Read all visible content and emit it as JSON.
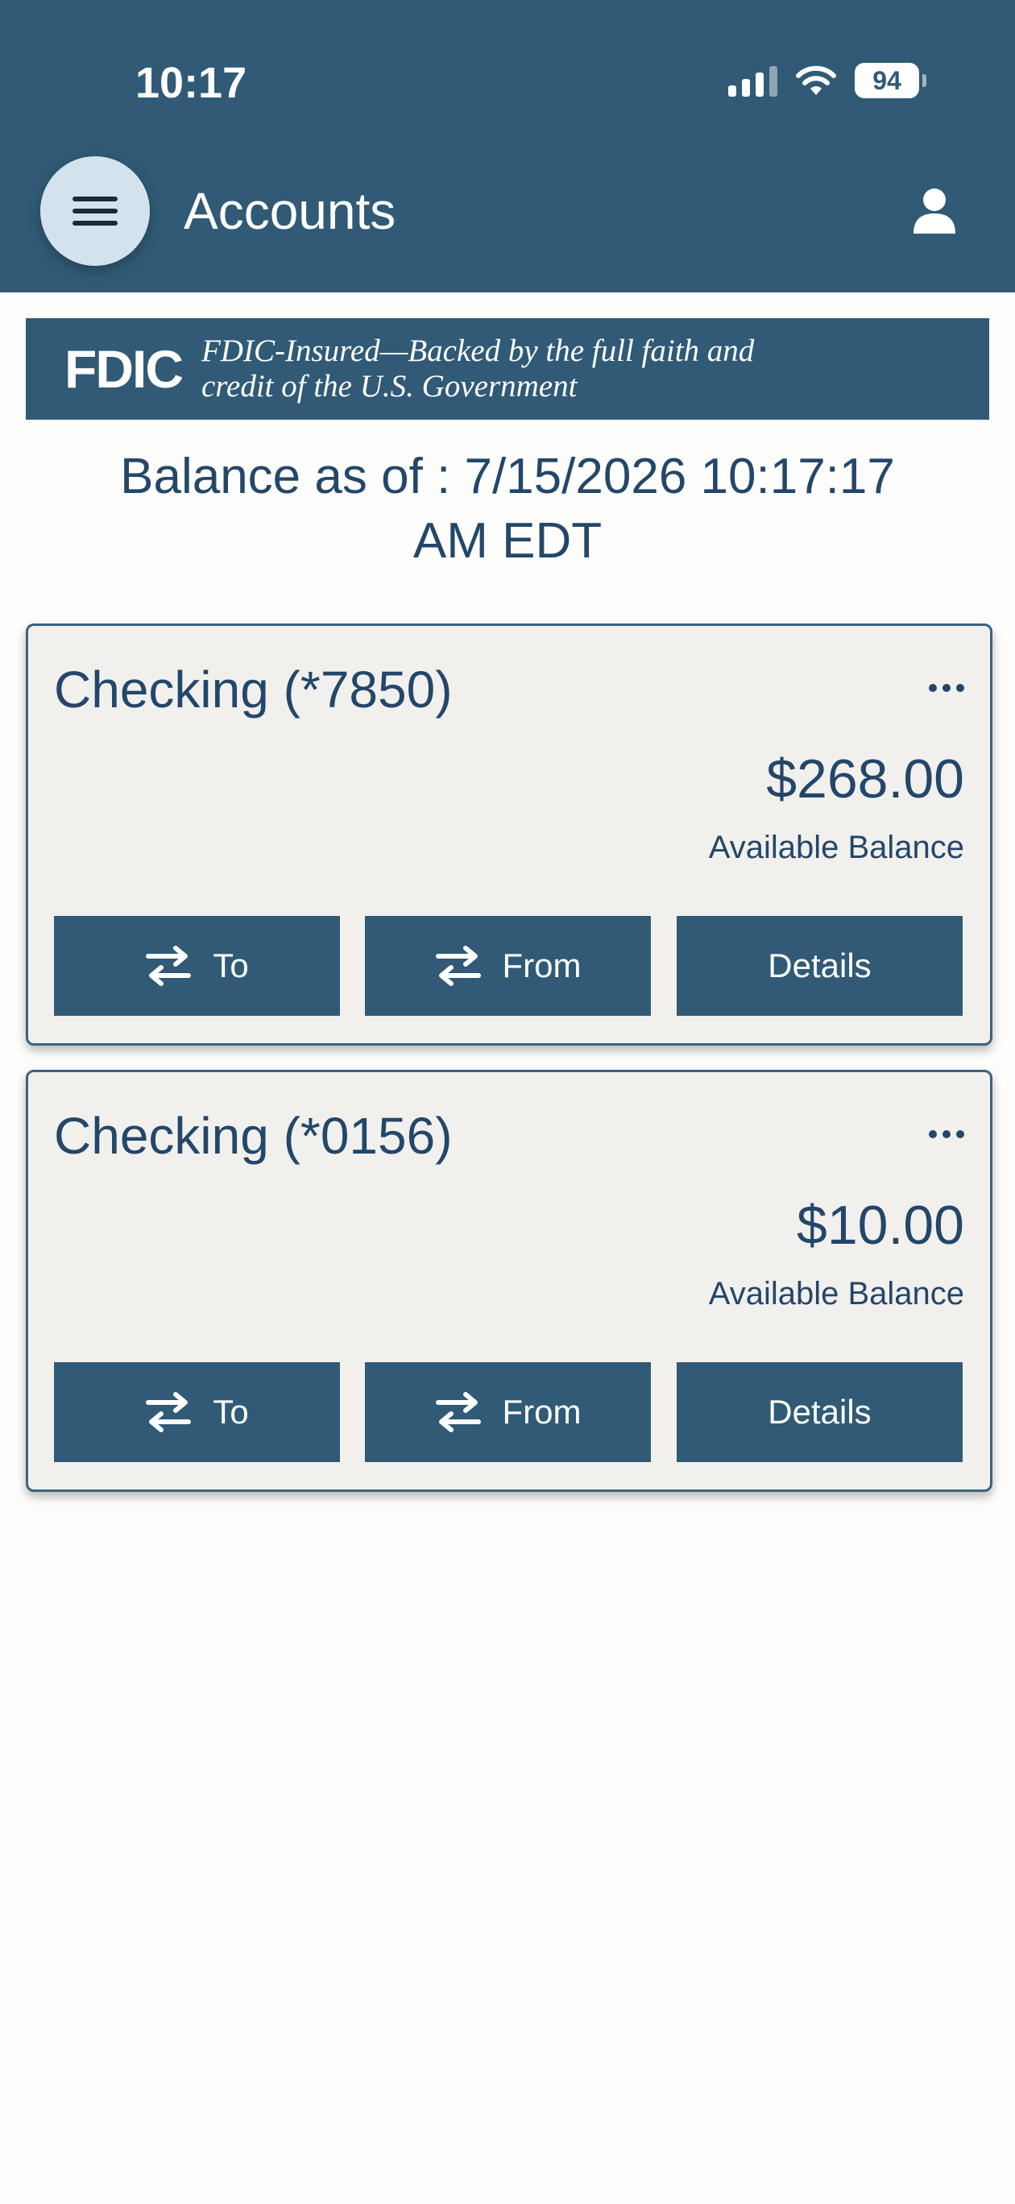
{
  "status_bar": {
    "time": "10:17",
    "battery": "94"
  },
  "header": {
    "title": "Accounts",
    "menu_icon": "hamburger-menu-icon",
    "profile_icon": "user-profile-icon"
  },
  "fdic": {
    "logo": "FDIC",
    "line1": "FDIC-Insured—Backed by the full faith and",
    "line2": "credit of the U.S. Government"
  },
  "balance_as_of": "Balance as of : 7/15/2026 10:17:17 AM EDT",
  "accounts": [
    {
      "name": "Checking (*7850)",
      "amount": "$268.00",
      "amount_label": "Available Balance",
      "buttons": {
        "to": "To",
        "from": "From",
        "details": "Details"
      }
    },
    {
      "name": "Checking (*0156)",
      "amount": "$10.00",
      "amount_label": "Available Balance",
      "buttons": {
        "to": "To",
        "from": "From",
        "details": "Details"
      }
    }
  ],
  "colors": {
    "primary": "#305a76",
    "text": "#23476a",
    "card_background": "#f2f0ed"
  }
}
